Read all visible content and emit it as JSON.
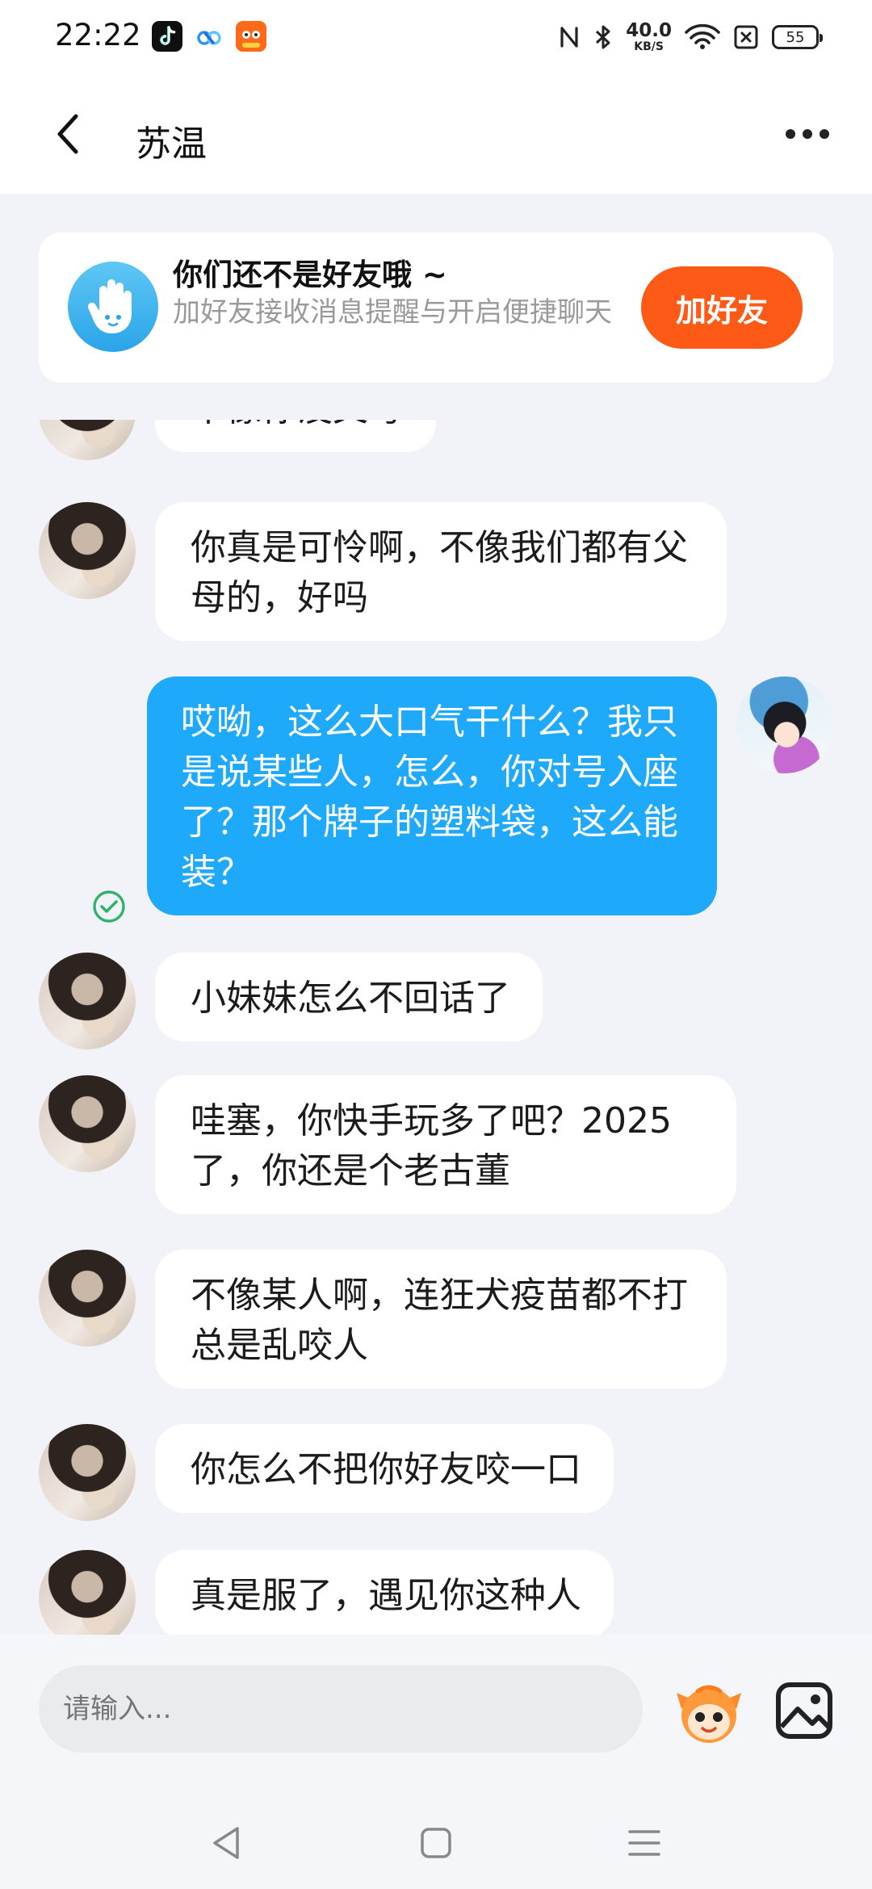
{
  "status_bar": {
    "time": "22:22",
    "net_speed_value": "40.0",
    "net_speed_unit": "KB/S",
    "battery": "55",
    "icons": [
      "tiktok-icon",
      "baidu-netdisk-icon",
      "taobao-icon",
      "nfc-icon",
      "bluetooth-icon",
      "wifi-icon",
      "sim-off-icon",
      "battery-icon"
    ]
  },
  "header": {
    "title": "苏温",
    "back_icon": "chevron-left-icon",
    "more_icon": "more-dots-icon"
  },
  "friend_card": {
    "title": "你们还不是好友哦 ~",
    "description": "加好友接收消息提醒与开启便捷聊天",
    "button": "加好友"
  },
  "messages": [
    {
      "sender": "other",
      "text": "不像你没父母"
    },
    {
      "sender": "other",
      "text": "你真是可怜啊，不像我们都有父母的，好吗"
    },
    {
      "sender": "me",
      "text": "哎呦，这么大口气干什么？我只是说某些人，怎么，你对号入座了？那个牌子的塑料袋，这么能装？",
      "read": true
    },
    {
      "sender": "other",
      "text": "小妹妹怎么不回话了"
    },
    {
      "sender": "other",
      "text": "哇塞，你快手玩多了吧？2025了，你还是个老古董"
    },
    {
      "sender": "other",
      "text": "不像某人啊，连狂犬疫苗都不打总是乱咬人"
    },
    {
      "sender": "other",
      "text": "你怎么不把你好友咬一口"
    },
    {
      "sender": "other",
      "text": "真是服了，遇见你这种人"
    }
  ],
  "input": {
    "placeholder": "请输入..."
  },
  "nav": {
    "icons": [
      "back-triangle-icon",
      "home-square-icon",
      "menu-lines-icon"
    ]
  },
  "colors": {
    "accent_orange": "#fe5a17",
    "my_bubble": "#1ea9fb",
    "background": "#f2f3f8"
  }
}
